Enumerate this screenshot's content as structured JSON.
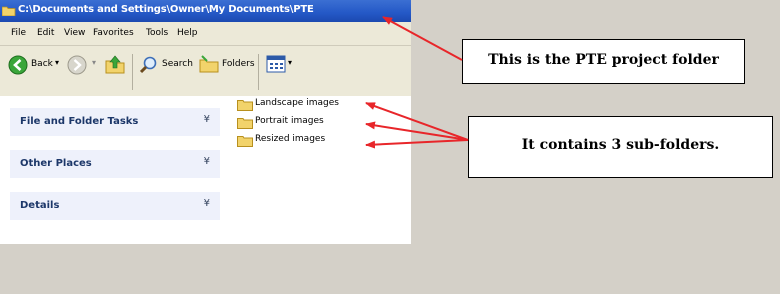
{
  "window": {
    "title": "C:\\Documents and Settings\\Owner\\My Documents\\PTE"
  },
  "menu": {
    "items": [
      "File",
      "Edit",
      "View",
      "Favorites",
      "Tools",
      "Help"
    ]
  },
  "toolbar": {
    "back_label": "Back",
    "search_label": "Search",
    "folders_label": "Folders",
    "dropdown_glyph": "▾"
  },
  "tasks": [
    {
      "label": "File and Folder Tasks",
      "chevron": "¥"
    },
    {
      "label": "Other Places",
      "chevron": "¥"
    },
    {
      "label": "Details",
      "chevron": "¥"
    }
  ],
  "folders": [
    {
      "name": "Landscape images"
    },
    {
      "name": "Portrait images"
    },
    {
      "name": "Resized images"
    }
  ],
  "annotations": {
    "project_folder": "This is the PTE project folder",
    "subfolders": "It contains 3 sub-folders."
  },
  "colors": {
    "arrow": "#e8262a",
    "titlebar": "#2458c6",
    "folder": "#f2d36b"
  }
}
